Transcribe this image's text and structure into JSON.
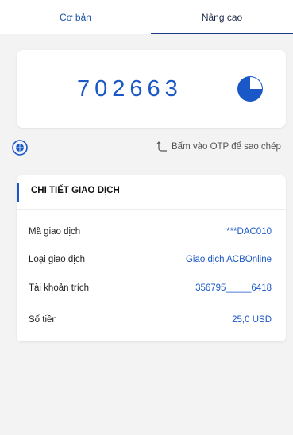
{
  "tabs": [
    {
      "label": "Cơ bản"
    },
    {
      "label": "Nâng cao"
    }
  ],
  "otp": {
    "code": "702663",
    "timer_fraction_remaining": 0.75
  },
  "hint": {
    "text": "Bấm vào OTP để sao chép"
  },
  "detail": {
    "title": "CHI TIẾT GIAO DỊCH",
    "rows": [
      {
        "label": "Mã giao dịch",
        "value": "***DAC010"
      },
      {
        "label": "Loại giao dịch",
        "value": "Giao dịch ACBOnline"
      },
      {
        "label": "Tài khoản trích",
        "value": "356795_____6418"
      },
      {
        "label": "Số tiền",
        "value": "25,0 USD"
      }
    ]
  },
  "colors": {
    "accent": "#1a57c7",
    "tab_indicator": "#1b3b86",
    "background": "#f3f3f3"
  },
  "icons": {
    "timer": "pie-timer-icon",
    "globe": "globe-icon",
    "hint_arrow": "curved-arrow-icon"
  }
}
